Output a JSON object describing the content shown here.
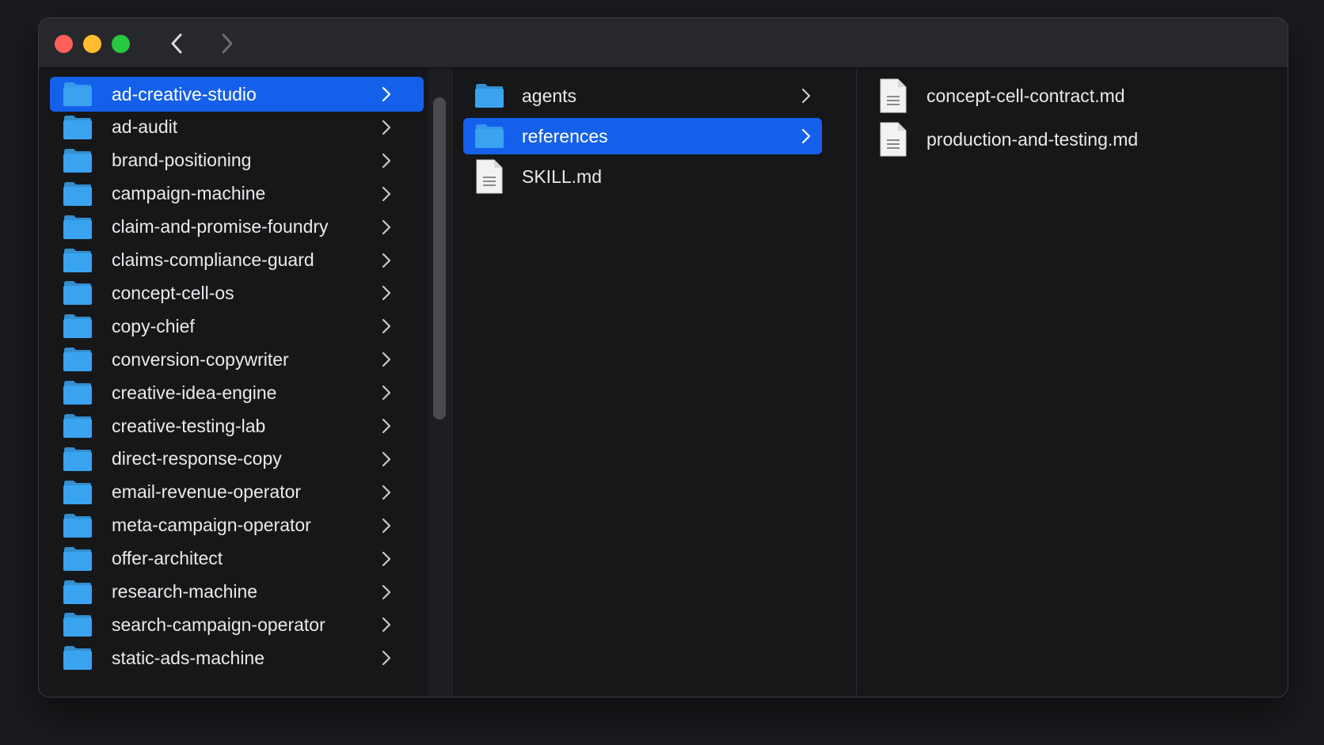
{
  "window": {
    "colors": {
      "accent": "#1560ea",
      "folder": "#3aa3f0",
      "close": "#ff5f57",
      "minimize": "#febc2e",
      "zoom": "#28c840"
    },
    "nav": {
      "back_icon": "chevron-left-icon",
      "forward_icon": "chevron-right-icon"
    }
  },
  "columns": [
    {
      "items": [
        {
          "label": "ad-creative-studio",
          "type": "folder",
          "selected": true
        },
        {
          "label": "ad-audit",
          "type": "folder"
        },
        {
          "label": "brand-positioning",
          "type": "folder"
        },
        {
          "label": "campaign-machine",
          "type": "folder"
        },
        {
          "label": "claim-and-promise-foundry",
          "type": "folder"
        },
        {
          "label": "claims-compliance-guard",
          "type": "folder"
        },
        {
          "label": "concept-cell-os",
          "type": "folder"
        },
        {
          "label": "copy-chief",
          "type": "folder"
        },
        {
          "label": "conversion-copywriter",
          "type": "folder"
        },
        {
          "label": "creative-idea-engine",
          "type": "folder"
        },
        {
          "label": "creative-testing-lab",
          "type": "folder"
        },
        {
          "label": "direct-response-copy",
          "type": "folder"
        },
        {
          "label": "email-revenue-operator",
          "type": "folder"
        },
        {
          "label": "meta-campaign-operator",
          "type": "folder"
        },
        {
          "label": "offer-architect",
          "type": "folder"
        },
        {
          "label": "research-machine",
          "type": "folder"
        },
        {
          "label": "search-campaign-operator",
          "type": "folder"
        },
        {
          "label": "static-ads-machine",
          "type": "folder"
        }
      ]
    },
    {
      "items": [
        {
          "label": "agents",
          "type": "folder"
        },
        {
          "label": "references",
          "type": "folder",
          "selected": true
        },
        {
          "label": "SKILL.md",
          "type": "file"
        }
      ]
    },
    {
      "items": [
        {
          "label": "concept-cell-contract.md",
          "type": "file"
        },
        {
          "label": "production-and-testing.md",
          "type": "file"
        }
      ]
    }
  ]
}
